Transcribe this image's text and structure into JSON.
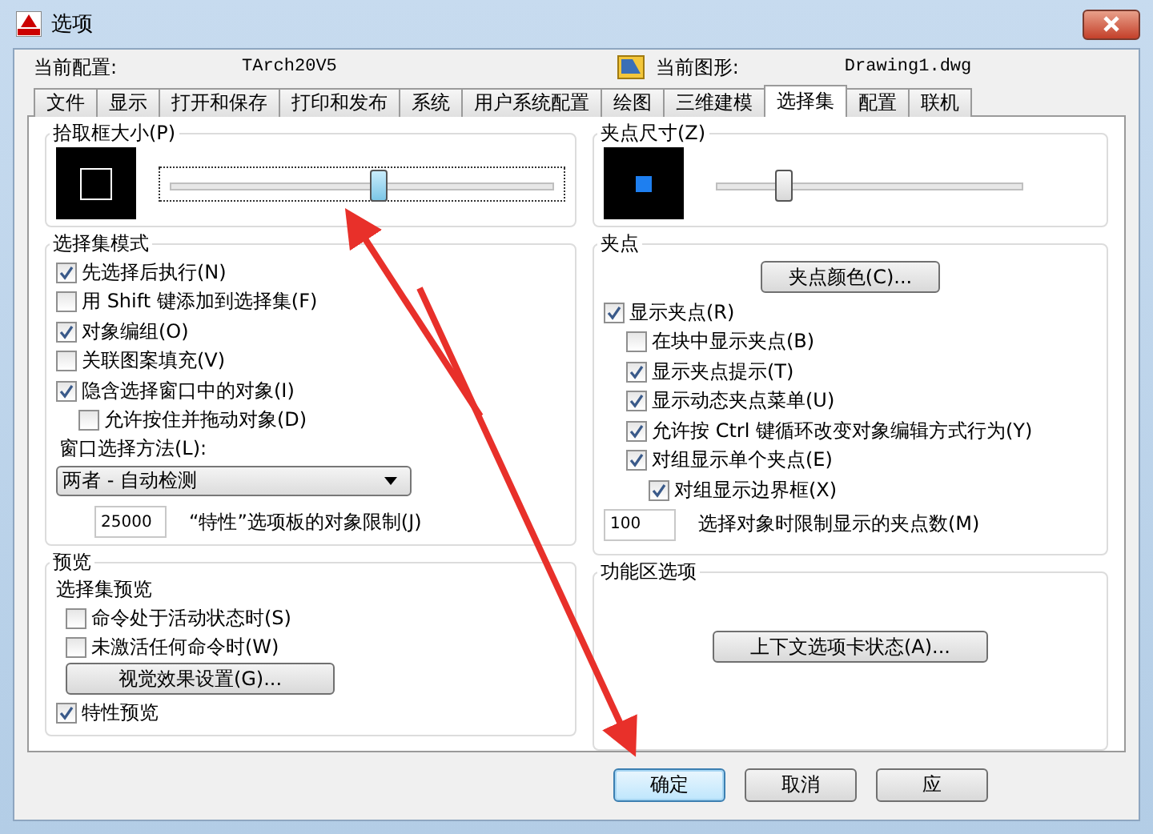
{
  "window": {
    "title": "选项"
  },
  "profile": {
    "label": "当前配置:",
    "value": "TArch20V5"
  },
  "drawing": {
    "label": "当前图形:",
    "value": "Drawing1.dwg"
  },
  "tabs": [
    {
      "label": "文件",
      "selected": false
    },
    {
      "label": "显示",
      "selected": false
    },
    {
      "label": "打开和保存",
      "selected": false
    },
    {
      "label": "打印和发布",
      "selected": false
    },
    {
      "label": "系统",
      "selected": false
    },
    {
      "label": "用户系统配置",
      "selected": false
    },
    {
      "label": "绘图",
      "selected": false
    },
    {
      "label": "三维建模",
      "selected": false
    },
    {
      "label": "选择集",
      "selected": true
    },
    {
      "label": "配置",
      "selected": false
    },
    {
      "label": "联机",
      "selected": false
    }
  ],
  "pickbox": {
    "title": "拾取框大小(P)",
    "level": 0.54
  },
  "selection_modes": {
    "title": "选择集模式",
    "options": [
      {
        "label": "先选择后执行(N)",
        "checked": true
      },
      {
        "label": "用 Shift 键添加到选择集(F)",
        "checked": false
      },
      {
        "label": "对象编组(O)",
        "checked": true
      },
      {
        "label": "关联图案填充(V)",
        "checked": false
      },
      {
        "label": "隐含选择窗口中的对象(I)",
        "checked": true,
        "children": [
          {
            "label": "允许按住并拖动对象(D)",
            "checked": false
          }
        ]
      }
    ]
  },
  "window_selection": {
    "label": "窗口选择方法(L):",
    "value": "两者 - 自动检测"
  },
  "property_limit": {
    "value": "25000",
    "label": "“特性”选项板的对象限制(J)"
  },
  "preview": {
    "title": "预览",
    "subtitle": "选择集预览",
    "options": [
      {
        "label": "命令处于活动状态时(S)",
        "checked": false
      },
      {
        "label": "未激活任何命令时(W)",
        "checked": false
      }
    ],
    "button": "视觉效果设置(G)...",
    "property_preview": {
      "label": "特性预览",
      "checked": true
    }
  },
  "grip_size": {
    "title": "夹点尺寸(Z)",
    "level": 0.22
  },
  "grips": {
    "title": "夹点",
    "color_button": "夹点颜色(C)...",
    "options": [
      {
        "label": "显示夹点(R)",
        "checked": true,
        "children": [
          {
            "label": "在块中显示夹点(B)",
            "checked": false
          },
          {
            "label": "显示夹点提示(T)",
            "checked": true
          },
          {
            "label": "显示动态夹点菜单(U)",
            "checked": true
          },
          {
            "label": "允许按 Ctrl 键循环改变对象编辑方式行为(Y)",
            "checked": true
          },
          {
            "label": "对组显示单个夹点(E)",
            "checked": true,
            "children": [
              {
                "label": "对组显示边界框(X)",
                "checked": true
              }
            ]
          }
        ]
      }
    ],
    "limit": {
      "value": "100",
      "label": "选择对象时限制显示的夹点数(M)"
    }
  },
  "ribbon": {
    "title": "功能区选项",
    "button": "上下文选项卡状态(A)..."
  },
  "buttons": [
    {
      "label": "确定",
      "default": true
    },
    {
      "label": "取消",
      "default": false
    },
    {
      "label": "应",
      "default": false
    }
  ]
}
